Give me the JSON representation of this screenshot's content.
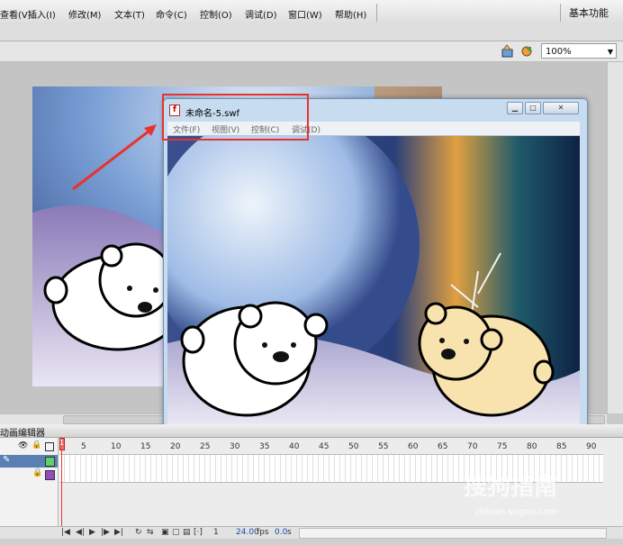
{
  "menubar": {
    "items": [
      "查看(V)",
      "插入(I)",
      "修改(M)",
      "文本(T)",
      "命令(C)",
      "控制(O)",
      "调试(D)",
      "窗口(W)",
      "帮助(H)"
    ],
    "workspace": "基本功能"
  },
  "toolbar": {
    "zoom": "100%"
  },
  "swf_window": {
    "title": "未命名-5.swf",
    "menus": [
      "文件(F)",
      "视图(V)",
      "控制(C)",
      "调试(D)"
    ],
    "icon": "flash-player-icon"
  },
  "timeline": {
    "panel_title": "动画编辑器",
    "frame_numbers": [
      "1",
      "5",
      "10",
      "15",
      "20",
      "25",
      "30",
      "35",
      "40",
      "45",
      "50",
      "55",
      "60",
      "65",
      "70",
      "75",
      "80",
      "85",
      "90"
    ],
    "current_frame": "1",
    "fps": "24.00",
    "fps_unit": "fps",
    "time": "0.0",
    "time_unit": "s"
  },
  "watermark": {
    "text": "搜狗指南",
    "url": "zhinan.sogou.com"
  },
  "colors": {
    "highlight": "#e8322e",
    "arrow": "#e8322e",
    "layer_selected": "#5a7fb3"
  }
}
